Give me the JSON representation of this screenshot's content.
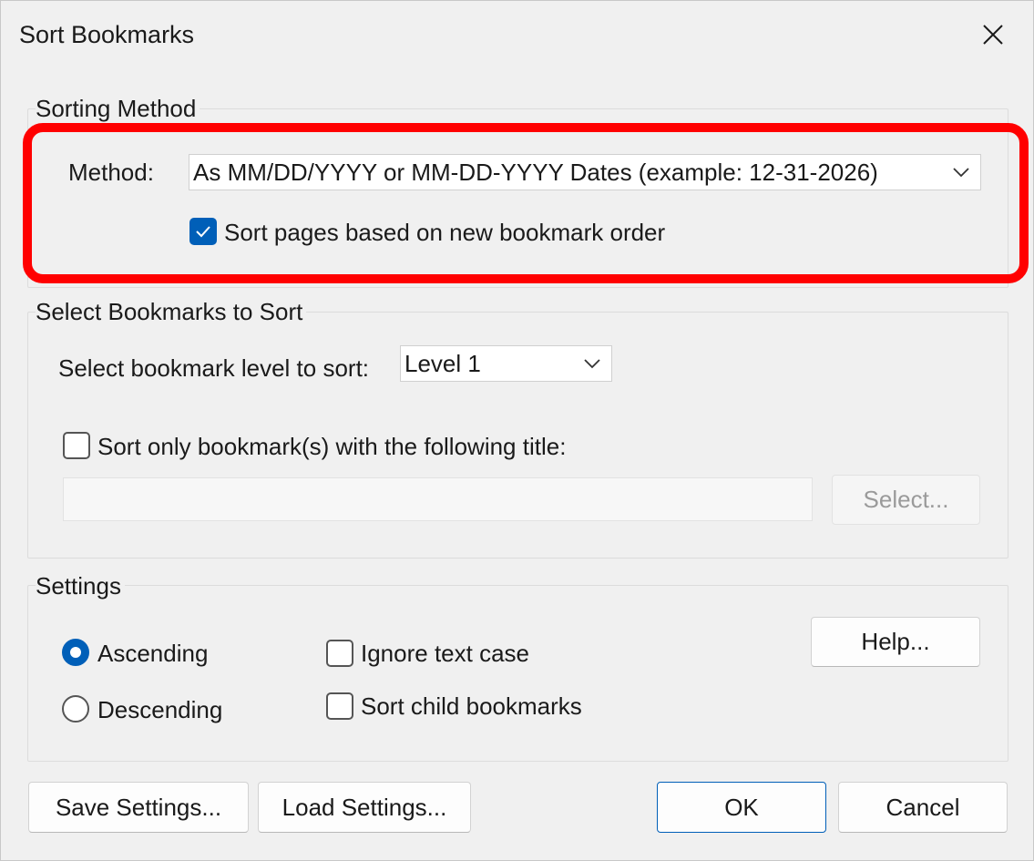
{
  "dialog": {
    "title": "Sort Bookmarks",
    "close_icon": "close-icon"
  },
  "sorting_method": {
    "group_label": "Sorting Method",
    "method_label": "Method:",
    "method_value": "As MM/DD/YYYY or MM-DD-YYYY Dates (example: 12-31-2026)",
    "sort_pages_label": "Sort pages based on new bookmark order",
    "sort_pages_checked": true,
    "highlight_color": "#ff0000"
  },
  "select_bookmarks": {
    "group_label": "Select Bookmarks to Sort",
    "level_label": "Select bookmark level to sort:",
    "level_value": "Level 1",
    "title_filter_label": "Sort only bookmark(s) with the following title:",
    "title_filter_checked": false,
    "title_input_value": "",
    "select_button": "Select..."
  },
  "settings": {
    "group_label": "Settings",
    "ascending_label": "Ascending",
    "descending_label": "Descending",
    "selected_order": "Ascending",
    "ignore_case_label": "Ignore text case",
    "ignore_case_checked": false,
    "sort_children_label": "Sort child bookmarks",
    "sort_children_checked": false,
    "help_button": "Help..."
  },
  "footer": {
    "save_settings": "Save Settings...",
    "load_settings": "Load Settings...",
    "ok": "OK",
    "cancel": "Cancel"
  },
  "colors": {
    "accent": "#005fb8",
    "background": "#f0f0f0"
  }
}
